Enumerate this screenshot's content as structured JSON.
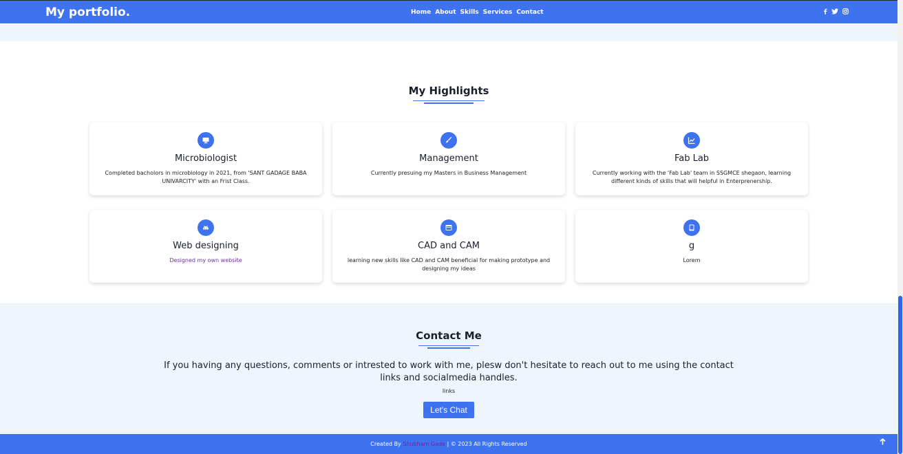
{
  "navbar": {
    "brand": "My portfolio.",
    "links": [
      "Home",
      "About",
      "Skills",
      "Services",
      "Contact"
    ],
    "social": [
      "facebook-icon",
      "twitter-icon",
      "instagram-icon"
    ]
  },
  "highlights": {
    "title": "My Highlights",
    "cards": [
      {
        "icon": "monitor-icon",
        "title": "Microbiologist",
        "desc": "Completed bacholors in microbiology in 2021, from 'SANT GADAGE BABA UNIVARCITY' with an Frist Class."
      },
      {
        "icon": "brush-icon",
        "title": "Management",
        "desc": "Currently presuing my Masters in Business Management"
      },
      {
        "icon": "chart-icon",
        "title": "Fab Lab",
        "desc": "Currently working with the 'Fab Lab' team in SSGMCE shegaon, learning different kinds of skills that will helpful in Enterprenership."
      },
      {
        "icon": "android-icon",
        "title": "Web designing",
        "desc": "Designed my own website"
      },
      {
        "icon": "window-icon",
        "title": "CAD and CAM",
        "desc": "learning new skills like CAD and CAM beneficial for making prototype and designing my ideas"
      },
      {
        "icon": "tablet-icon",
        "title": "g",
        "desc": "Lorem"
      }
    ]
  },
  "contact": {
    "title": "Contact Me",
    "text": "If you having any questions, comments or intrested to work with me, plesw don't hesitate to reach out to me using the contact links and socialmedia handles.",
    "links_label": "links",
    "button": "Let's Chat"
  },
  "footer": {
    "created_by": "Created By ",
    "author": "Shubham Gade",
    "rights": " | © 2023 All Rights Reserved"
  },
  "colors": {
    "accent": "#3f72ef",
    "light_bg": "#eef5fc"
  }
}
